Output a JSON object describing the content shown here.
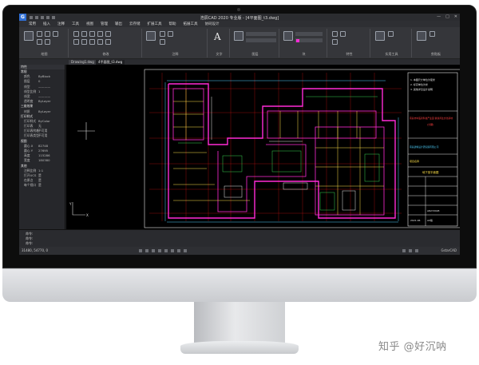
{
  "app": {
    "title": "浩辰CAD 2020 专业版 - [4平面图_t3.dwg]",
    "logo_letter": "G",
    "brand": "GstarCAD"
  },
  "menu": [
    "常用",
    "插入",
    "注释",
    "工具",
    "视图",
    "管理",
    "输出",
    "云存储",
    "扩展工具",
    "帮助",
    "拓展工具",
    "协同设计"
  ],
  "ribbon_groups": [
    {
      "label": "绘图"
    },
    {
      "label": "修改"
    },
    {
      "label": "注释"
    },
    {
      "label": "图层"
    },
    {
      "label": "块"
    },
    {
      "label": "特性"
    },
    {
      "label": "实用工具"
    },
    {
      "label": "剪贴板"
    }
  ],
  "ribbon_text_label": "文字",
  "document_tabs": [
    "Drawing1.dwg",
    "4平面图_t3.dwg"
  ],
  "properties": {
    "header": "特性",
    "sections": [
      {
        "title": "常规",
        "rows": [
          [
            "颜色",
            "ByBlock"
          ],
          [
            "图层",
            "0"
          ],
          [
            "线型",
            "————"
          ],
          [
            "线型比例",
            "1"
          ],
          [
            "线宽",
            "————"
          ],
          [
            "透明度",
            "ByLayer"
          ]
        ]
      },
      {
        "title": "三维效果",
        "rows": [
          [
            "材质",
            "ByLayer"
          ]
        ]
      },
      {
        "title": "打印样式",
        "rows": [
          [
            "打印样式",
            "ByColor"
          ],
          [
            "打印表",
            "无"
          ],
          [
            "打印表附着",
            "不可用"
          ],
          [
            "打印表类型",
            "不可用"
          ]
        ]
      },
      {
        "title": "视图",
        "rows": [
          [
            "圆心 X",
            "82748"
          ],
          [
            "圆心 Y",
            "27695"
          ],
          [
            "高度",
            "115286"
          ],
          [
            "宽度",
            "180380"
          ]
        ]
      },
      {
        "title": "其他",
        "rows": [
          [
            "注释比例",
            "1:1"
          ],
          [
            "打开UCS",
            "是"
          ],
          [
            "在原点",
            "是"
          ],
          [
            "每个视口",
            "是"
          ]
        ]
      }
    ]
  },
  "title_block": {
    "red_title": "南昌市中医药科技产业园 健康养生文化基地",
    "red_sub": "(分期)",
    "company": "南昌建筑设计研究院有限公司",
    "drawing_name": "地下室平面图",
    "project_label": "项目名称",
    "sheet_no": "A8272028",
    "date": "2021.06",
    "scale": "A0版",
    "notes": [
      "1. 本图尺寸单位为毫米",
      "2. 标高单位为米",
      "3. 其他详见设计说明"
    ]
  },
  "command": {
    "lines": [
      "命令:",
      "命令:",
      "命令:"
    ],
    "prompt": "命令:"
  },
  "status": {
    "coords": "31480, 54770, 0"
  },
  "watermark": "知乎 @好沉呐",
  "colors": {
    "wall": "#ff2bd6",
    "grid": "#d81414",
    "detail_yellow": "#ffe14a",
    "detail_green": "#39d353",
    "detail_white": "#e8e8e8",
    "accent_blue": "#2f6fd6"
  }
}
